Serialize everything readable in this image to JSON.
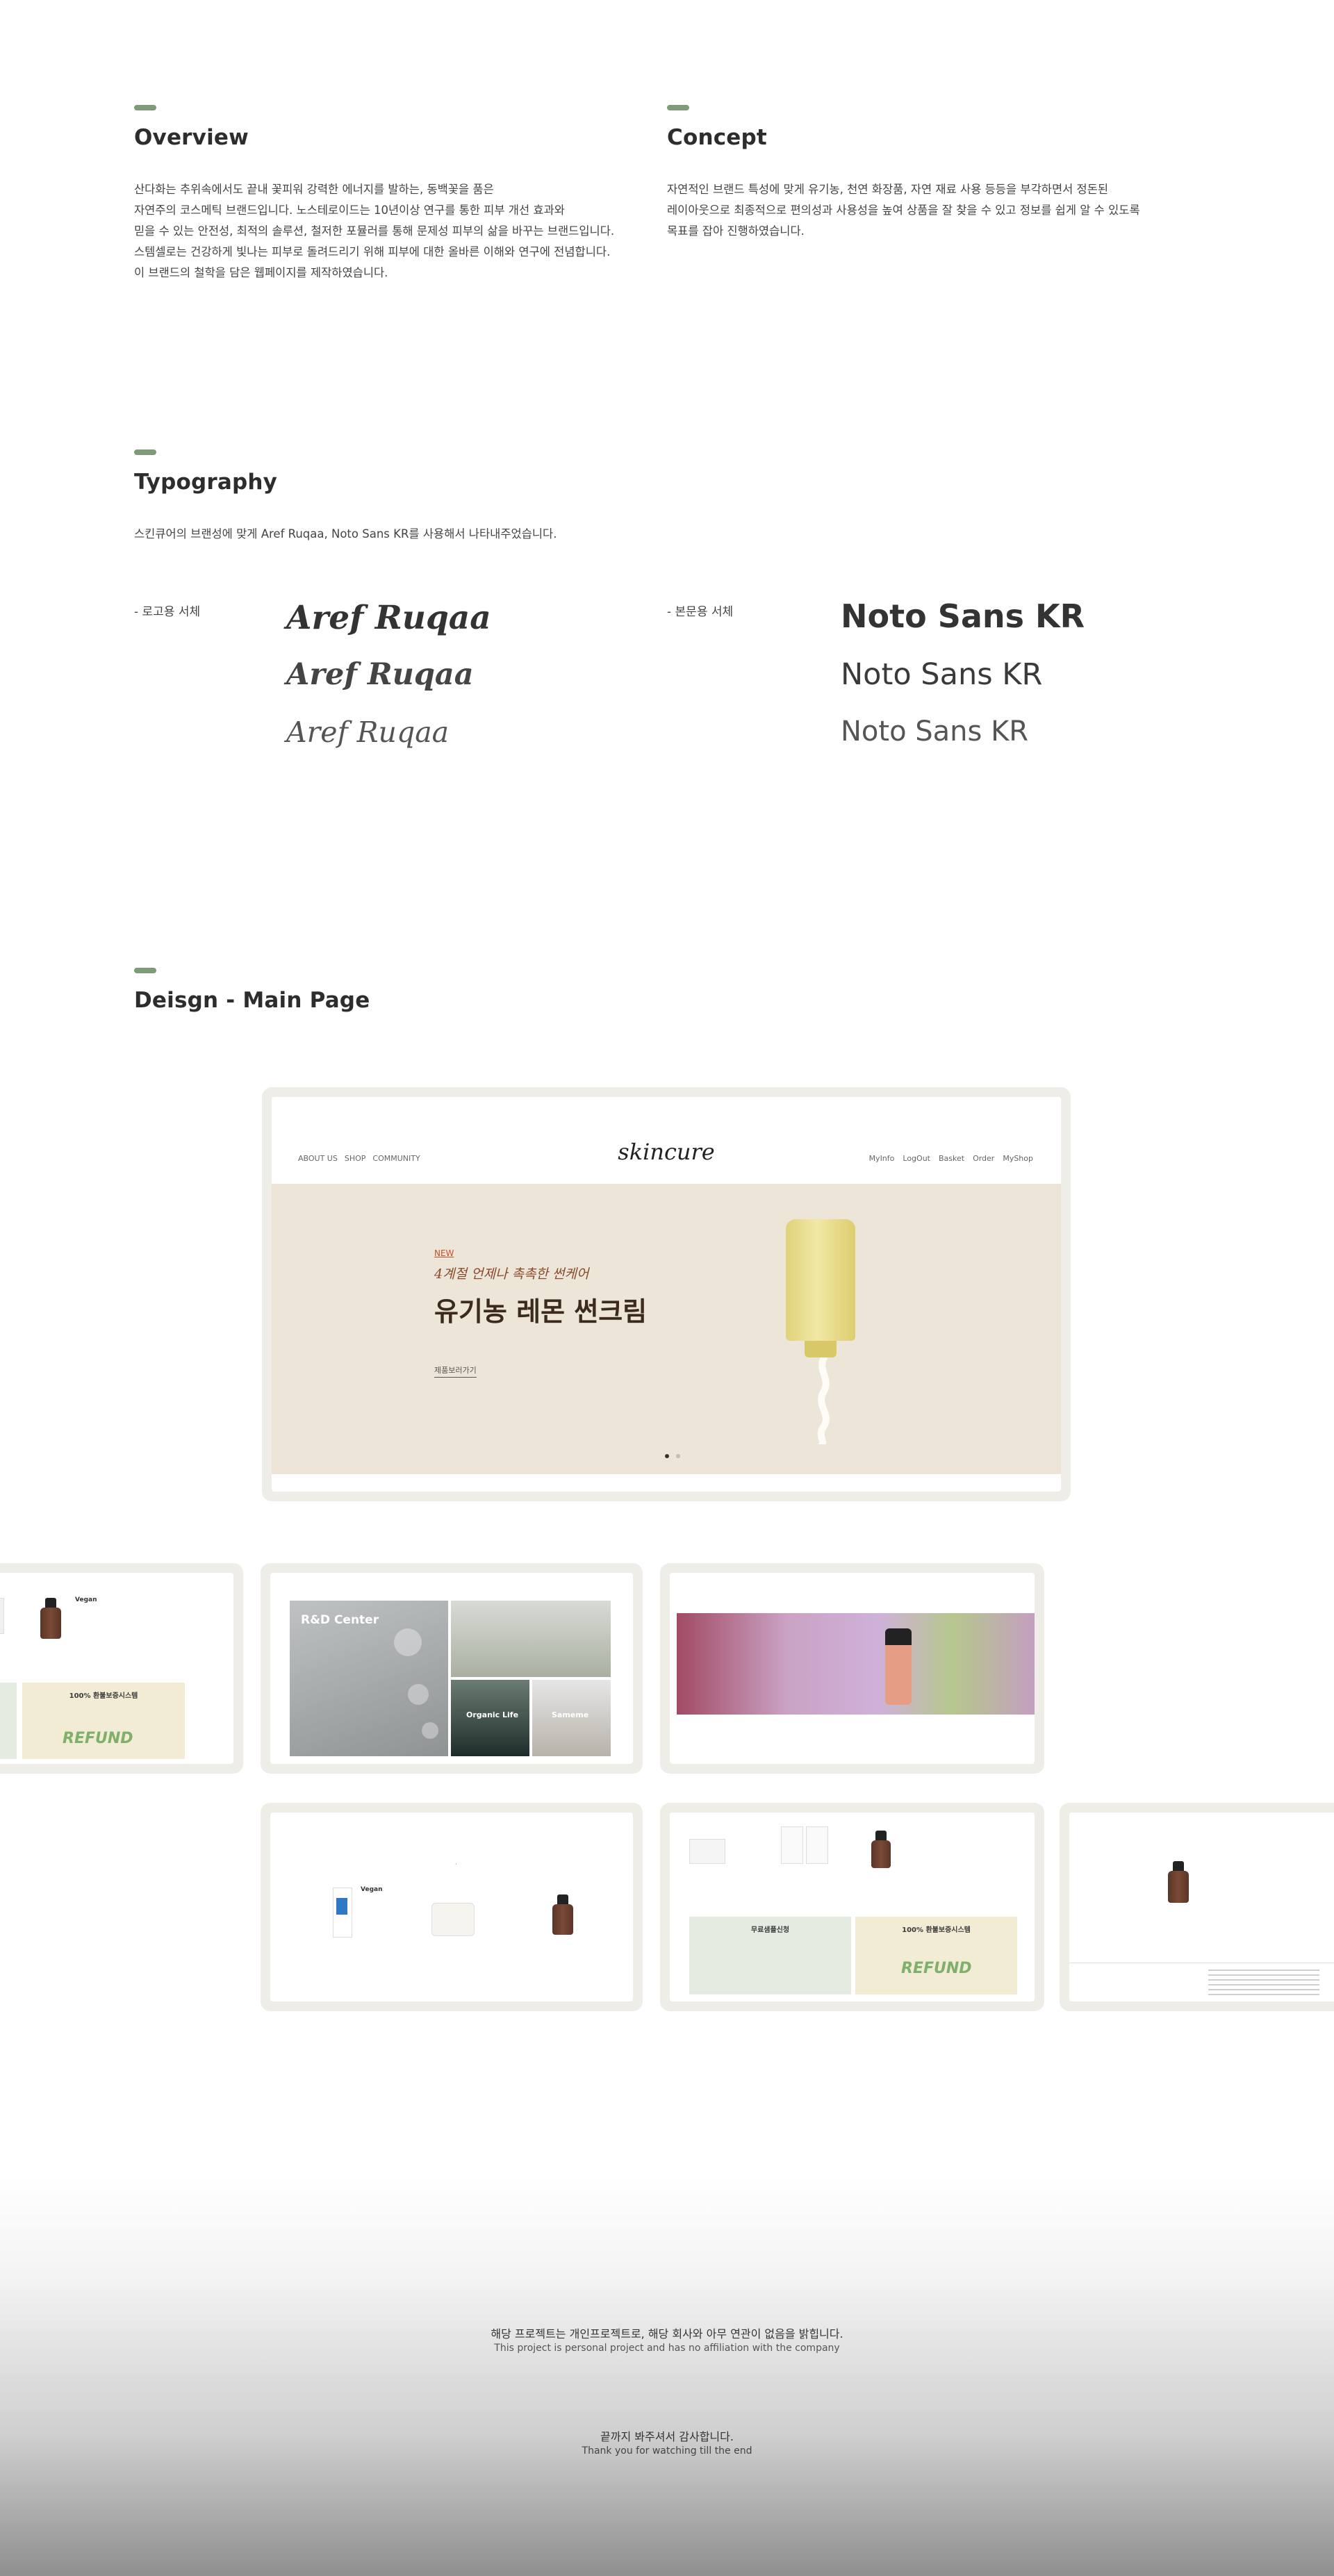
{
  "overview": {
    "title": "Overview",
    "text": "산다화는 추위속에서도 끝내 꽃피워 강력한 에너지를 발하는, 동백꽃을 품은\n자연주의 코스메틱 브랜드입니다. 노스테로이드는 10년이상 연구를 통한 피부 개선 효과와\n믿을 수 있는 안전성, 최적의 솔루션, 철저한 포뮬러를 통해 문제성 피부의 삶을 바꾸는 브랜드입니다.\n스템셀로는 건강하게 빛나는 피부로 돌려드리기 위해 피부에 대한 올바른 이해와 연구에 전념합니다.\n이 브랜드의 철학을 담은 웹페이지를 제작하였습니다."
  },
  "concept": {
    "title": "Concept",
    "text": "자연적인 브랜드 특성에 맞게 유기농, 천연 화장품, 자연 재료 사용 등등을 부각하면서 정돈된\n레이아웃으로 최종적으로 편의성과 사용성을 높여 상품을 잘 찾을 수 있고 정보를 쉽게 알 수 있도록\n목표를 잡아 진행하였습니다."
  },
  "typography": {
    "title": "Typography",
    "desc": "스킨큐어의 브랜성에 맞게 Aref Ruqaa, Noto Sans KR를 사용해서 나타내주었습니다.",
    "logo_label": "- 로고용 서체",
    "logo_font": "Aref Ruqaa",
    "body_label": "- 본문용 서체",
    "body_font": "Noto Sans KR"
  },
  "design": {
    "title": "Deisgn - Main Page"
  },
  "mockup": {
    "logo": "skincure",
    "nav_left": [
      "ABOUT US",
      "SHOP",
      "COMMUNITY"
    ],
    "nav_right": [
      "MyInfo",
      "LogOut",
      "Basket",
      "Order",
      "MyShop"
    ],
    "hero_new": "NEW",
    "hero_sub": "4계절 언제나 촉촉한 썬케어",
    "hero_title": "유기농 레몬 썬크림",
    "hero_link": "제품보러가기"
  },
  "cards": {
    "rd_title": "R&D Center",
    "organic": "Organic Life",
    "sameme": "Sameme",
    "refund_banner": "100% 환불보증시스템",
    "refund_word": "REFUND",
    "free_sample": "무료샘플신청",
    "vegan": "Vegan"
  },
  "footer": {
    "line1": "해당 프로젝트는 개인프로젝트로, 해당 회사와 아무 연관이 없음을 밝힙니다.",
    "line1_en": "This project is personal project and has no affiliation with the company",
    "line2": "끝까지 봐주셔서 감사합니다.",
    "line2_en": "Thank you for watching till the end"
  },
  "colors": {
    "accent": "#7f9a78",
    "frame": "#efede7",
    "hero_bg": "#ede6d8"
  }
}
